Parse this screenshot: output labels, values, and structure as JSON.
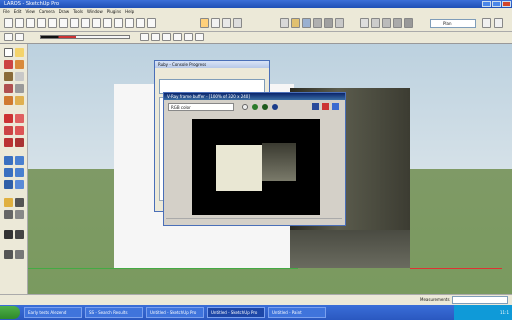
{
  "app": {
    "title": "LAROS - SketchUp Pro"
  },
  "menus": [
    "File",
    "Edit",
    "View",
    "Camera",
    "Draw",
    "Tools",
    "Window",
    "Plugins",
    "Help"
  ],
  "toolbar": {
    "style_dropdown_value": "Plan"
  },
  "dialog_rubycon": {
    "title": "Ruby - Console Progress"
  },
  "vray_window": {
    "title": "V-Ray frame buffer - [100% of 320 x 240]",
    "channel_value": "RGB color"
  },
  "status": {
    "measurements_label": "Measurements"
  },
  "taskbar": {
    "tasks": [
      {
        "label": "Early tests Alezend"
      },
      {
        "label": "SS - Search Results"
      },
      {
        "label": "Untitled - SketchUp Pro"
      },
      {
        "label": "Untitled - SketchUp Pro"
      },
      {
        "label": "Untitled - Paint"
      }
    ],
    "clock": "11:1"
  }
}
